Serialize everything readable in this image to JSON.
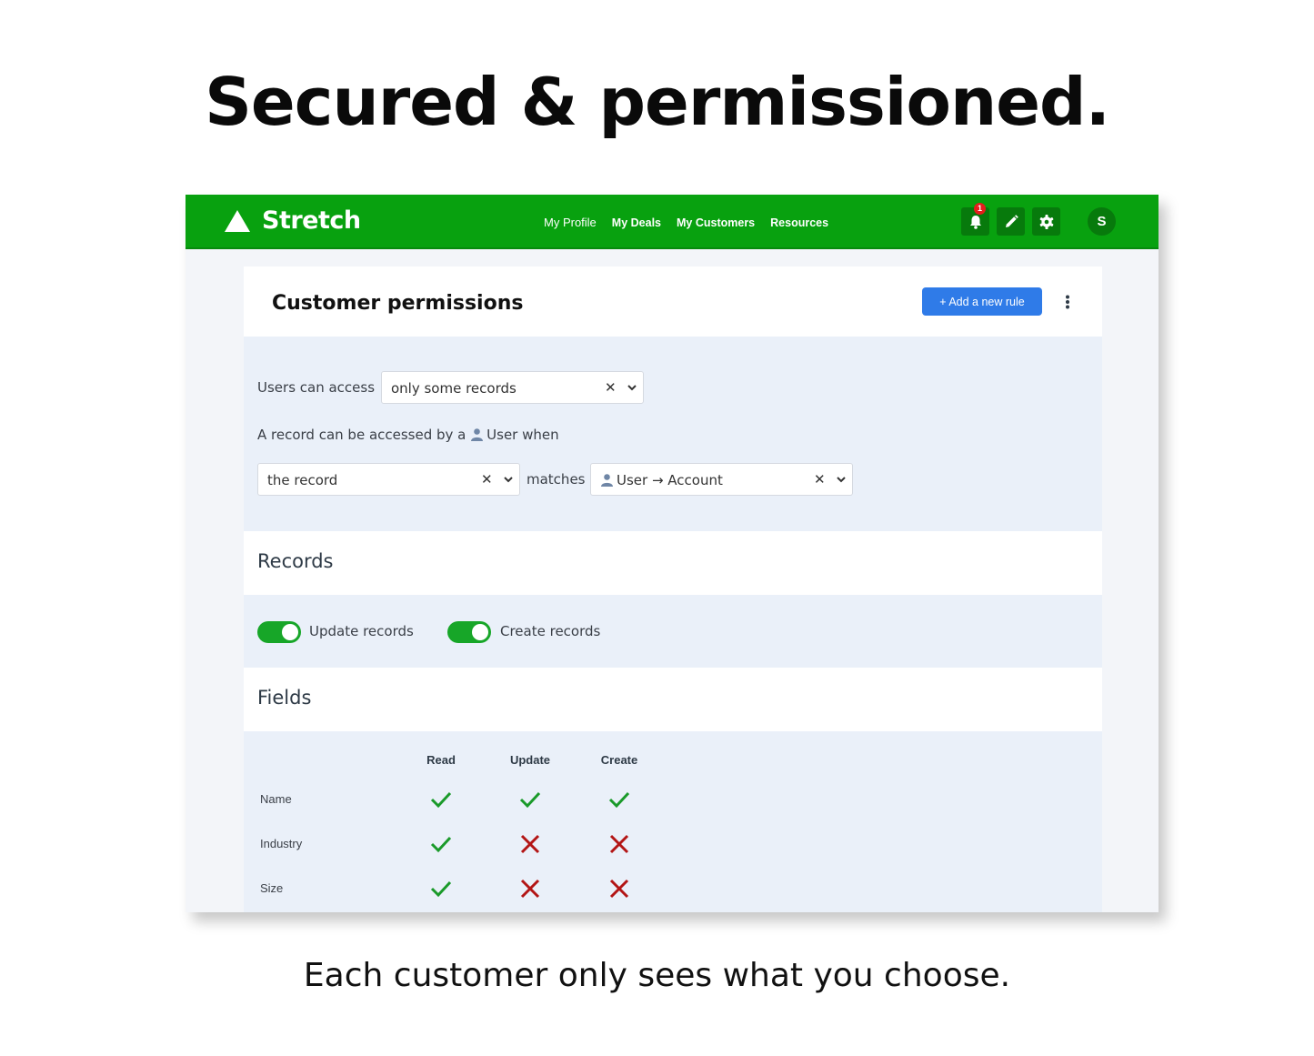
{
  "headline": "Secured & permissioned.",
  "tagline": "Each customer only sees what you choose.",
  "app": {
    "brand": "Stretch",
    "nav": {
      "links": [
        "My Profile",
        "My Deals",
        "My Customers",
        "Resources"
      ],
      "notification_count": "1",
      "avatar_initial": "S"
    },
    "colors": {
      "brand_green": "#08a10f",
      "button_blue": "#2f7be8",
      "check_green": "#1a9a2a",
      "cross_red": "#b31515"
    },
    "card": {
      "title": "Customer permissions",
      "add_rule_label": "+ Add a new rule",
      "rule": {
        "access_label": "Users can access",
        "access_value": "only some records",
        "condition_prefix": "A record can be accessed by a",
        "condition_user": "User",
        "condition_suffix": "when",
        "left_value": "the record",
        "operator": "matches",
        "right_value": "User → Account"
      },
      "records": {
        "title": "Records",
        "toggles": [
          {
            "label": "Update records",
            "on": true
          },
          {
            "label": "Create records",
            "on": true
          }
        ]
      },
      "fields": {
        "title": "Fields",
        "columns": [
          "Read",
          "Update",
          "Create"
        ],
        "rows": [
          {
            "name": "Name",
            "read": true,
            "update": true,
            "create": true
          },
          {
            "name": "Industry",
            "read": true,
            "update": false,
            "create": false
          },
          {
            "name": "Size",
            "read": true,
            "update": false,
            "create": false
          }
        ]
      }
    }
  }
}
